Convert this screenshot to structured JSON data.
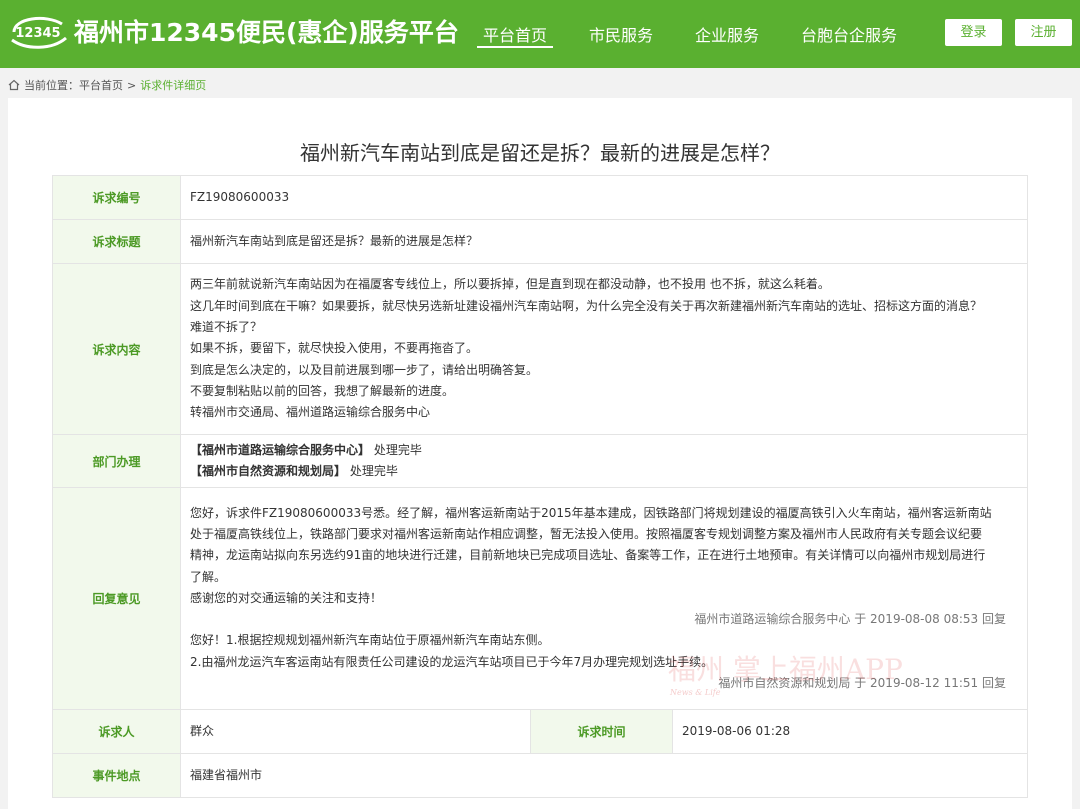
{
  "header": {
    "logo_text": "12345",
    "site_title": "福州市12345便民(惠企)服务平台",
    "nav": [
      {
        "label": "平台首页"
      },
      {
        "label": "市民服务"
      },
      {
        "label": "企业服务"
      },
      {
        "label": "台胞台企服务"
      }
    ],
    "login_label": "登录",
    "register_label": "注册"
  },
  "breadcrumb": {
    "prefix": "当前位置：",
    "home": "平台首页",
    "separator": ">",
    "current": "诉求件详细页"
  },
  "page_title": "福州新汽车南站到底是留还是拆？最新的进展是怎样？",
  "detail": {
    "number_label": "诉求编号",
    "number_value": "FZ19080600033",
    "title_label": "诉求标题",
    "title_value": "福州新汽车南站到底是留还是拆？最新的进展是怎样？",
    "content_label": "诉求内容",
    "content_lines": [
      "两三年前就说新汽车南站因为在福厦客专线位上，所以要拆掉，但是直到现在都没动静，也不投用 也不拆，就这么耗着。",
      "这几年时间到底在干嘛？如果要拆，就尽快另选新址建设福州汽车南站啊，为什么完全没有关于再次新建福州新汽车南站的选址、招标这方面的消息？",
      "难道不拆了？",
      "如果不拆，要留下，就尽快投入使用，不要再拖沓了。",
      "到底是怎么决定的，以及目前进展到哪一步了，请给出明确答复。",
      "不要复制粘贴以前的回答，我想了解最新的进度。",
      "转福州市交通局、福州道路运输综合服务中心"
    ],
    "dept_label": "部门办理",
    "depts": [
      {
        "name": "【福州市道路运输综合服务中心】",
        "status": "处理完毕"
      },
      {
        "name": "【福州市自然资源和规划局】",
        "status": "处理完毕"
      }
    ],
    "reply_label": "回复意见",
    "reply1_lines": [
      "您好，诉求件FZ19080600033号悉。经了解，福州客运新南站于2015年基本建成，因铁路部门将规划建设的福厦高铁引入火车南站，福州客运新南站",
      "处于福厦高铁线位上，铁路部门要求对福州客运新南站作相应调整，暂无法投入使用。按照福厦客专规划调整方案及福州市人民政府有关专题会议纪要",
      "精神，龙运南站拟向东另选约91亩的地块进行迁建，目前新地块已完成项目选址、备案等工作，正在进行土地预审。有关详情可以向福州市规划局进行",
      "了解。",
      "感谢您的对交通运输的关注和支持！"
    ],
    "reply1_meta": "福州市道路运输综合服务中心 于 2019-08-08 08:53 回复",
    "reply2_lines": [
      "您好！1.根据控规规划福州新汽车南站位于原福州新汽车南站东侧。",
      "2.由福州龙运汽车客运南站有限责任公司建设的龙运汽车站项目已于今年7月办理完规划选址手续。"
    ],
    "reply2_meta": "福州市自然资源和规划局 于 2019-08-12 11:51 回复",
    "requester_label": "诉求人",
    "requester_value": "群众",
    "time_label": "诉求时间",
    "time_value": "2019-08-06 01:28",
    "location_label": "事件地点",
    "location_value": "福建省福州市"
  },
  "watermark": {
    "text": "福州 掌上福州APP",
    "sub": "News & Life"
  },
  "colors": {
    "brand_green": "#5ab030",
    "label_bg": "#f2f9ec",
    "label_text": "#4c9a25"
  }
}
